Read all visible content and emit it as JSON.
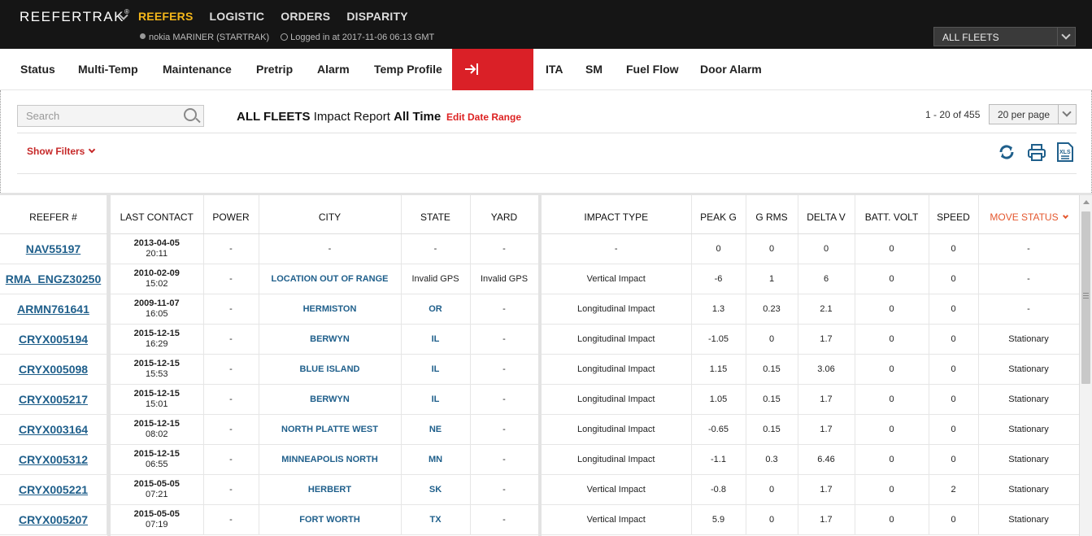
{
  "app": {
    "brand": "REEFERTRAK",
    "brand_mark": "®",
    "nav": [
      "REEFERS",
      "LOGISTIC",
      "ORDERS",
      "DISPARITY"
    ],
    "active_nav": "REEFERS",
    "user": "nokia MARINER (STARTRAK)",
    "login_info": "Logged in at 2017-11-06 06:13 GMT",
    "fleet_select": "ALL FLEETS"
  },
  "tabs": [
    "Status",
    "Multi-Temp",
    "Maintenance",
    "Pretrip",
    "Alarm",
    "Temp Profile",
    "Impact",
    "ITA",
    "SM",
    "Fuel Flow",
    "Door Alarm"
  ],
  "active_tab": "Impact",
  "toolbar": {
    "search_placeholder": "Search",
    "report_fleet": "ALL FLEETS",
    "report_name": "Impact Report",
    "report_range": "All Time",
    "edit_date_range": "Edit Date Range",
    "count": "1 - 20 of 455",
    "per_page": "20 per page",
    "show_filters": "Show Filters",
    "icons": [
      "refresh-icon",
      "print-icon",
      "xls-export-icon"
    ]
  },
  "table": {
    "columns_left": [
      "REEFER #"
    ],
    "columns_mid": [
      "LAST CONTACT",
      "POWER",
      "CITY",
      "STATE",
      "YARD"
    ],
    "columns_right": [
      "IMPACT TYPE",
      "PEAK G",
      "G RMS",
      "DELTA V",
      "BATT. VOLT",
      "SPEED",
      "MOVE STATUS"
    ],
    "rows": [
      {
        "reefer": "NAV55197",
        "date": "2013-04-05",
        "time": "20:11",
        "power": "-",
        "city": "-",
        "state": "-",
        "yard": "-",
        "impact": "-",
        "peak_g": "0",
        "g_rms": "0",
        "delta_v": "0",
        "batt": "0",
        "speed": "0",
        "move": "-"
      },
      {
        "reefer": "RMA_ENGZ30250",
        "date": "2010-02-09",
        "time": "15:02",
        "power": "-",
        "city": "LOCATION OUT OF RANGE",
        "state": "Invalid GPS",
        "yard": "Invalid GPS",
        "impact": "Vertical Impact",
        "peak_g": "-6",
        "g_rms": "1",
        "delta_v": "6",
        "batt": "0",
        "speed": "0",
        "move": "-"
      },
      {
        "reefer": "ARMN761641",
        "date": "2009-11-07",
        "time": "16:05",
        "power": "-",
        "city": "HERMISTON",
        "state": "OR",
        "yard": "-",
        "impact": "Longitudinal Impact",
        "peak_g": "1.3",
        "g_rms": "0.23",
        "delta_v": "2.1",
        "batt": "0",
        "speed": "0",
        "move": "-"
      },
      {
        "reefer": "CRYX005194",
        "date": "2015-12-15",
        "time": "16:29",
        "power": "-",
        "city": "BERWYN",
        "state": "IL",
        "yard": "-",
        "impact": "Longitudinal Impact",
        "peak_g": "-1.05",
        "g_rms": "0",
        "delta_v": "1.7",
        "batt": "0",
        "speed": "0",
        "move": "Stationary"
      },
      {
        "reefer": "CRYX005098",
        "date": "2015-12-15",
        "time": "15:53",
        "power": "-",
        "city": "BLUE ISLAND",
        "state": "IL",
        "yard": "-",
        "impact": "Longitudinal Impact",
        "peak_g": "1.15",
        "g_rms": "0.15",
        "delta_v": "3.06",
        "batt": "0",
        "speed": "0",
        "move": "Stationary"
      },
      {
        "reefer": "CRYX005217",
        "date": "2015-12-15",
        "time": "15:01",
        "power": "-",
        "city": "BERWYN",
        "state": "IL",
        "yard": "-",
        "impact": "Longitudinal Impact",
        "peak_g": "1.05",
        "g_rms": "0.15",
        "delta_v": "1.7",
        "batt": "0",
        "speed": "0",
        "move": "Stationary"
      },
      {
        "reefer": "CRYX003164",
        "date": "2015-12-15",
        "time": "08:02",
        "power": "-",
        "city": "NORTH PLATTE WEST",
        "state": "NE",
        "yard": "-",
        "impact": "Longitudinal Impact",
        "peak_g": "-0.65",
        "g_rms": "0.15",
        "delta_v": "1.7",
        "batt": "0",
        "speed": "0",
        "move": "Stationary"
      },
      {
        "reefer": "CRYX005312",
        "date": "2015-12-15",
        "time": "06:55",
        "power": "-",
        "city": "MINNEAPOLIS NORTH",
        "state": "MN",
        "yard": "-",
        "impact": "Longitudinal Impact",
        "peak_g": "-1.1",
        "g_rms": "0.3",
        "delta_v": "6.46",
        "batt": "0",
        "speed": "0",
        "move": "Stationary"
      },
      {
        "reefer": "CRYX005221",
        "date": "2015-05-05",
        "time": "07:21",
        "power": "-",
        "city": "HERBERT",
        "state": "SK",
        "yard": "-",
        "impact": "Vertical Impact",
        "peak_g": "-0.8",
        "g_rms": "0",
        "delta_v": "1.7",
        "batt": "0",
        "speed": "2",
        "move": "Stationary"
      },
      {
        "reefer": "CRYX005207",
        "date": "2015-05-05",
        "time": "07:19",
        "power": "-",
        "city": "FORT WORTH",
        "state": "TX",
        "yard": "-",
        "impact": "Vertical Impact",
        "peak_g": "5.9",
        "g_rms": "0",
        "delta_v": "1.7",
        "batt": "0",
        "speed": "0",
        "move": "Stationary"
      }
    ]
  }
}
